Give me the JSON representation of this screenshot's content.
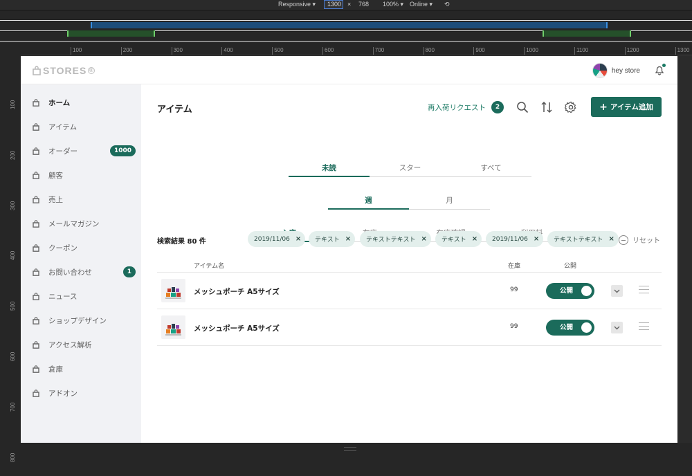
{
  "devtools": {
    "device": "Responsive ▾",
    "width": "1300",
    "times": "×",
    "height": "768",
    "zoom": "100% ▾",
    "network": "Online ▾",
    "ruler_top": [
      "100",
      "200",
      "300",
      "400",
      "500",
      "600",
      "700",
      "800",
      "900",
      "1000",
      "1100",
      "1200",
      "1300"
    ],
    "ruler_left": [
      "100",
      "200",
      "300",
      "400",
      "500",
      "600",
      "700",
      "800"
    ]
  },
  "header": {
    "logo_text": "STORES",
    "logo_mark": "®",
    "store_name": "hey store"
  },
  "sidebar": {
    "items": [
      {
        "label": "ホーム",
        "icon": "bag-icon",
        "active": true
      },
      {
        "label": "アイテム",
        "icon": "bag-icon"
      },
      {
        "label": "オーダー",
        "icon": "bag-icon",
        "badge": "1000"
      },
      {
        "label": "顧客",
        "icon": "bag-icon"
      },
      {
        "label": "売上",
        "icon": "bag-icon"
      },
      {
        "label": "メールマガジン",
        "icon": "bag-icon"
      },
      {
        "label": "クーポン",
        "icon": "bag-icon"
      },
      {
        "label": "お問い合わせ",
        "icon": "bag-icon",
        "badge": "1"
      },
      {
        "label": "ニュース",
        "icon": "bag-icon"
      },
      {
        "label": "ショップデザイン",
        "icon": "bag-icon"
      },
      {
        "label": "アクセス解析",
        "icon": "bag-icon"
      },
      {
        "label": "倉庫",
        "icon": "bag-icon"
      },
      {
        "label": "アドオン",
        "icon": "bag-icon"
      }
    ]
  },
  "main": {
    "title": "アイテム",
    "restock_label": "再入荷リクエスト",
    "restock_count": "2",
    "add_button": "アイテム追加",
    "tabs1": [
      "未読",
      "スター",
      "すべて"
    ],
    "tabs2": [
      "週",
      "月"
    ],
    "tabs3": [
      "入庫",
      "在庫",
      "在庫確認",
      "利用料"
    ],
    "results_label": "検索結果 80 件",
    "chips": [
      "2019/11/06",
      "テキスト",
      "テキストテキスト",
      "テキスト",
      "2019/11/06",
      "テキストテキスト"
    ],
    "chip_close": "×",
    "reset_label": "リセット",
    "columns": {
      "name": "アイテム名",
      "stock": "在庫",
      "public": "公開"
    },
    "rows": [
      {
        "name": "メッシュポーチ A5サイズ",
        "stock": "99",
        "status": "公開"
      },
      {
        "name": "メッシュポーチ A5サイズ",
        "stock": "99",
        "status": "公開"
      }
    ]
  },
  "colors": {
    "accent": "#1b6b5b",
    "sidebar_bg": "#f1f2f5",
    "chip_bg": "#e3efec"
  }
}
